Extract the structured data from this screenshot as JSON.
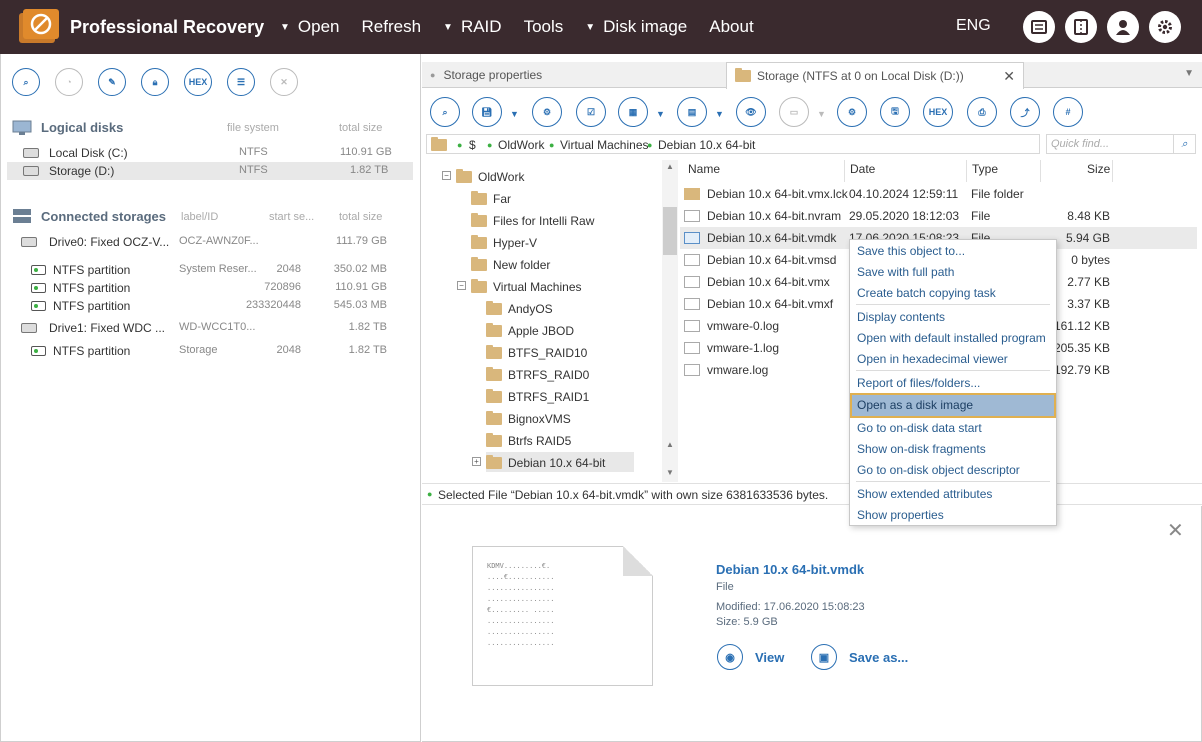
{
  "app": {
    "title": "Professional Recovery",
    "lang": "ENG"
  },
  "menu": {
    "open": "Open",
    "refresh": "Refresh",
    "raid": "RAID",
    "tools": "Tools",
    "disk_image": "Disk image",
    "about": "About"
  },
  "left": {
    "logical_header": "Logical disks",
    "logical_cols": {
      "fs": "file system",
      "size": "total size"
    },
    "logical": [
      {
        "name": "Local Disk (C:)",
        "fs": "NTFS",
        "size": "110.91 GB"
      },
      {
        "name": "Storage (D:)",
        "fs": "NTFS",
        "size": "1.82 TB"
      }
    ],
    "connected_header": "Connected storages",
    "connected_cols": {
      "label": "label/ID",
      "start": "start se...",
      "size": "total size"
    },
    "storages": [
      {
        "name": "Drive0: Fixed OCZ-V...",
        "label": "OCZ-AWNZ0F...",
        "start": "",
        "size": "111.79 GB",
        "type": "drive"
      },
      {
        "name": "NTFS partition",
        "label": "System Reser...",
        "start": "2048",
        "size": "350.02 MB",
        "type": "part"
      },
      {
        "name": "NTFS partition",
        "label": "",
        "start": "720896",
        "size": "110.91 GB",
        "type": "part"
      },
      {
        "name": "NTFS partition",
        "label": "",
        "start": "233320448",
        "size": "545.03 MB",
        "type": "part"
      },
      {
        "name": "Drive1: Fixed WDC ...",
        "label": "WD-WCC1T0...",
        "start": "",
        "size": "1.82 TB",
        "type": "drive"
      },
      {
        "name": "NTFS partition",
        "label": "Storage",
        "start": "2048",
        "size": "1.82 TB",
        "type": "part"
      }
    ]
  },
  "tabs": {
    "storage_props": "Storage properties",
    "storage_ntfs": "Storage (NTFS at 0 on Local Disk (D:))"
  },
  "path": {
    "root": "$",
    "p1": "OldWork",
    "p2": "Virtual Machines",
    "p3": "Debian 10.x 64-bit",
    "find_placeholder": "Quick find..."
  },
  "tree": [
    {
      "label": "OldWork",
      "level": 0,
      "exp": "−"
    },
    {
      "label": "Far",
      "level": 1,
      "exp": ""
    },
    {
      "label": "Files for Intelli Raw",
      "level": 1,
      "exp": ""
    },
    {
      "label": "Hyper-V",
      "level": 1,
      "exp": ""
    },
    {
      "label": "New folder",
      "level": 1,
      "exp": ""
    },
    {
      "label": "Virtual Machines",
      "level": 1,
      "exp": "−"
    },
    {
      "label": "AndyOS",
      "level": 2,
      "exp": ""
    },
    {
      "label": "Apple JBOD",
      "level": 2,
      "exp": ""
    },
    {
      "label": "BTFS_RAID10",
      "level": 2,
      "exp": ""
    },
    {
      "label": "BTRFS_RAID0",
      "level": 2,
      "exp": ""
    },
    {
      "label": "BTRFS_RAID1",
      "level": 2,
      "exp": ""
    },
    {
      "label": "BignoxVMS",
      "level": 2,
      "exp": ""
    },
    {
      "label": "Btrfs RAID5",
      "level": 2,
      "exp": ""
    },
    {
      "label": "Debian 10.x 64-bit",
      "level": 2,
      "exp": "+"
    }
  ],
  "files_header": {
    "name": "Name",
    "date": "Date",
    "type": "Type",
    "size": "Size"
  },
  "files": [
    {
      "name": "Debian 10.x 64-bit.vmx.lck",
      "date": "04.10.2024 12:59:11",
      "type": "File folder",
      "size": "",
      "icon": "fold"
    },
    {
      "name": "Debian 10.x 64-bit.nvram",
      "date": "29.05.2020 18:12:03",
      "type": "File",
      "size": "8.48 KB",
      "icon": "file"
    },
    {
      "name": "Debian 10.x 64-bit.vmdk",
      "date": "17.06.2020 15:08:23",
      "type": "File",
      "size": "5.94 GB",
      "icon": "vm"
    },
    {
      "name": "Debian 10.x 64-bit.vmsd",
      "date": "",
      "type": "",
      "size": "0 bytes",
      "icon": "file"
    },
    {
      "name": "Debian 10.x 64-bit.vmx",
      "date": "",
      "type": "",
      "size": "2.77 KB",
      "icon": "file"
    },
    {
      "name": "Debian 10.x 64-bit.vmxf",
      "date": "",
      "type": "",
      "size": "3.37 KB",
      "icon": "file"
    },
    {
      "name": "vmware-0.log",
      "date": "",
      "type": "",
      "size": "161.12 KB",
      "icon": "file"
    },
    {
      "name": "vmware-1.log",
      "date": "",
      "type": "",
      "size": "205.35 KB",
      "icon": "file"
    },
    {
      "name": "vmware.log",
      "date": "",
      "type": "",
      "size": "192.79 KB",
      "icon": "file"
    }
  ],
  "status": "Selected File “Debian 10.x 64-bit.vmdk” with own size 6381633536 bytes.",
  "context_menu": [
    "Save this object to...",
    "Save with full path",
    "Create batch copying task",
    "Display contents",
    "Open with default installed program",
    "Open in hexadecimal viewer",
    "Report of files/folders...",
    "Open as a disk image",
    "Go to on-disk data start",
    "Show on-disk fragments",
    "Go to on-disk object descriptor",
    "Show extended attributes",
    "Show properties"
  ],
  "preview": {
    "title": "Debian 10.x 64-bit.vmdk",
    "kind": "File",
    "modified": "Modified: 17.06.2020 15:08:23",
    "size": "Size: 5.9 GB",
    "view": "View",
    "save_as": "Save as...",
    "hex_sample": "KDMV.........€.\n....€...........\n................\n................\n€......... .....\n................\n................\n................"
  },
  "colors": {
    "titlebar": "#3a2a2e",
    "accent": "#2a6fb3",
    "status_dot": "#3cb043",
    "menu_highlight": "#9fb9d4"
  }
}
